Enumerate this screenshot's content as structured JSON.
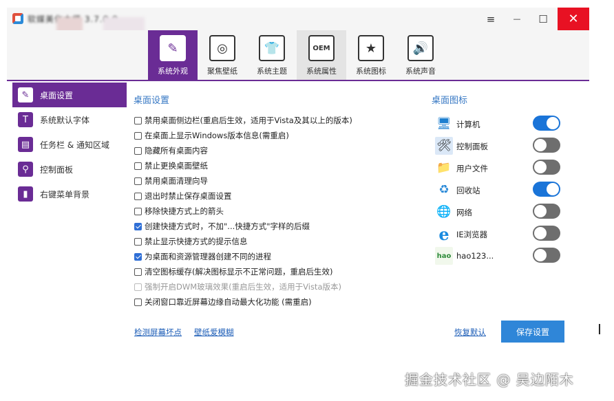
{
  "window": {
    "title": "软媒美化大师 3.7.0.0"
  },
  "titlebar": {
    "menu_glyph": "≡",
    "minimize_glyph": "—",
    "maximize_glyph": "☐",
    "close_glyph": "✕"
  },
  "tabs": [
    {
      "label": "系统外观",
      "icon": "paintbrush-icon",
      "glyph": "✎"
    },
    {
      "label": "聚焦壁纸",
      "icon": "target-icon",
      "glyph": "◎"
    },
    {
      "label": "系统主题",
      "icon": "shirt-icon",
      "glyph": "👕"
    },
    {
      "label": "系统属性",
      "icon": "oem-icon",
      "glyph": "OEM"
    },
    {
      "label": "系统图标",
      "icon": "star-icon",
      "glyph": "★"
    },
    {
      "label": "系统声音",
      "icon": "speaker-icon",
      "glyph": "🔊"
    }
  ],
  "sidebar": {
    "items": [
      {
        "label": "桌面设置",
        "icon": "desktop-brush-icon",
        "glyph": "✎"
      },
      {
        "label": "系统默认字体",
        "icon": "font-icon",
        "glyph": "T"
      },
      {
        "label": "任务栏 & 通知区域",
        "icon": "taskbar-icon",
        "glyph": "▤"
      },
      {
        "label": "控制面板",
        "icon": "control-panel-icon",
        "glyph": "⚲"
      },
      {
        "label": "右键菜单背景",
        "icon": "context-menu-icon",
        "glyph": "▮"
      }
    ]
  },
  "desktop_settings": {
    "title": "桌面设置",
    "options": [
      {
        "label": "禁用桌面侧边栏(重启后生效，适用于Vista及其以上的版本)",
        "checked": false
      },
      {
        "label": "在桌面上显示Windows版本信息(需重启)",
        "checked": false
      },
      {
        "label": "隐藏所有桌面内容",
        "checked": false
      },
      {
        "label": "禁止更换桌面壁纸",
        "checked": false
      },
      {
        "label": "禁用桌面清理向导",
        "checked": false
      },
      {
        "label": "退出时禁止保存桌面设置",
        "checked": false
      },
      {
        "label": "移除快捷方式上的箭头",
        "checked": false
      },
      {
        "label": "创建快捷方式时，不加\"...快捷方式\"字样的后缀",
        "checked": true
      },
      {
        "label": "禁止显示快捷方式的提示信息",
        "checked": false
      },
      {
        "label": "为桌面和资源管理器创建不同的进程",
        "checked": true
      },
      {
        "label": "清空图标缓存(解决图标显示不正常问题，重启后生效)",
        "checked": false
      },
      {
        "label": "强制开启DWM玻璃效果(重启后生效，适用于Vista版本)",
        "checked": false,
        "disabled": true
      },
      {
        "label": "关闭窗口靠近屏幕边缘自动最大化功能 (需重启)",
        "checked": false
      }
    ]
  },
  "desktop_icons": {
    "title": "桌面图标",
    "items": [
      {
        "label": "计算机",
        "icon": "computer-icon",
        "glyph": "🖥",
        "on": true
      },
      {
        "label": "控制面板",
        "icon": "control-panel-icon",
        "glyph": "🛠",
        "on": false
      },
      {
        "label": "用户文件",
        "icon": "folder-icon",
        "glyph": "📁",
        "on": false
      },
      {
        "label": "回收站",
        "icon": "recycle-bin-icon",
        "glyph": "♻",
        "on": true
      },
      {
        "label": "网络",
        "icon": "network-icon",
        "glyph": "🌐",
        "on": false
      },
      {
        "label": "IE浏览器",
        "icon": "ie-browser-icon",
        "glyph": "e",
        "on": false
      },
      {
        "label": "hao123...",
        "icon": "hao123-icon",
        "glyph": "hao",
        "on": false
      }
    ]
  },
  "footer": {
    "detect_link": "检测屏幕坏点",
    "wallpaper_link": "壁纸爱模糊",
    "restore_link": "恢复默认",
    "save_button": "保存设置"
  },
  "watermark": "掘金技术社区 @ 吴边陌木",
  "colors": {
    "accent": "#6a2c95",
    "primary_blue": "#2f86d8",
    "toggle_on": "#1a74d8",
    "title_link": "#3778c4"
  }
}
